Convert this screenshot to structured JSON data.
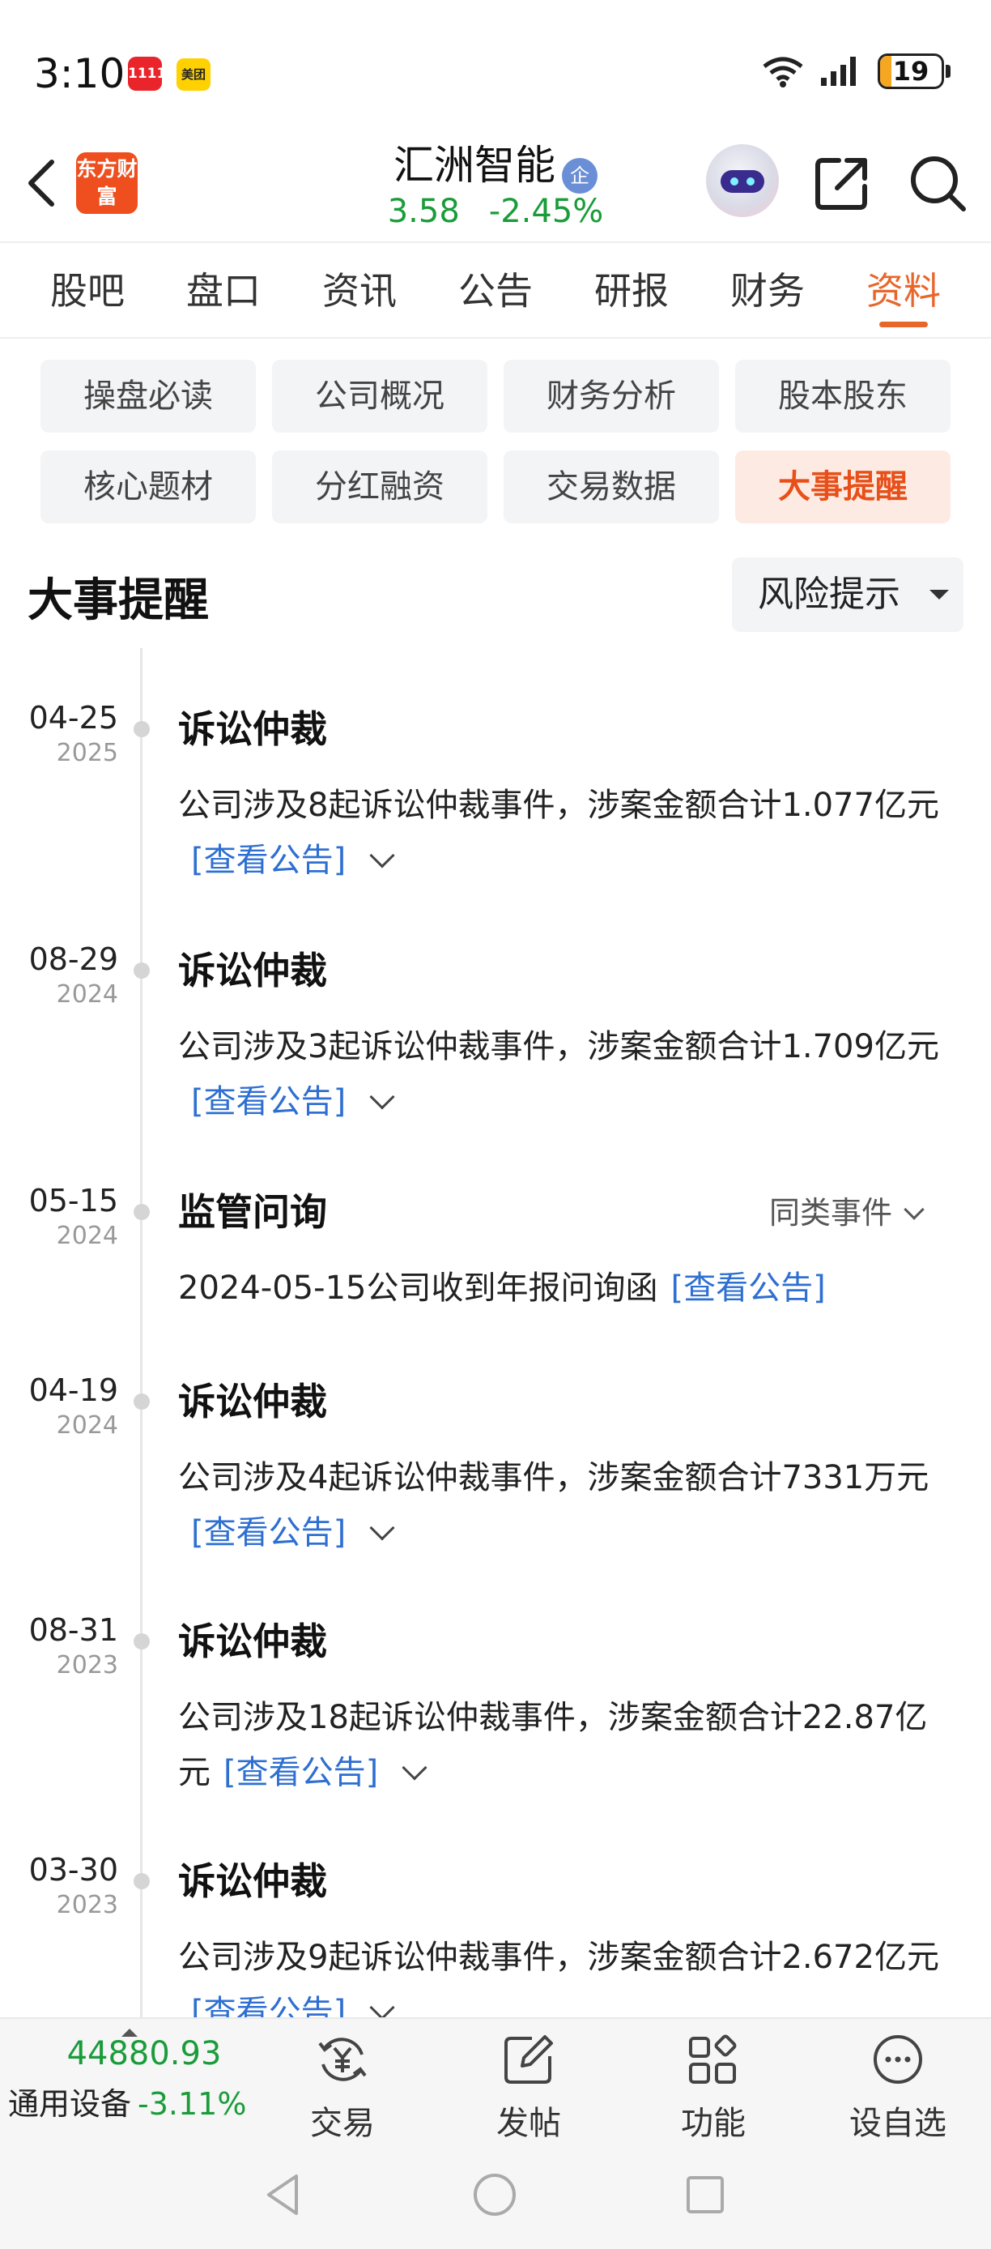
{
  "status_bar": {
    "time": "3:10",
    "app_icon_1": "1111",
    "app_icon_2": "美团",
    "battery": "19"
  },
  "header": {
    "logo_text": "东方财富",
    "stock_name": "汇洲智能",
    "badge": "企",
    "price": "3.58",
    "change_pct": "-2.45%",
    "price_color": "#1a9c3a"
  },
  "tabs": [
    "股吧",
    "盘口",
    "资讯",
    "公告",
    "研报",
    "财务",
    "资料"
  ],
  "active_tab": "资料",
  "subtabs": [
    "操盘必读",
    "公司概况",
    "财务分析",
    "股本股东",
    "核心题材",
    "分红融资",
    "交易数据",
    "大事提醒"
  ],
  "active_subtab": "大事提醒",
  "section": {
    "title": "大事提醒",
    "filter": "风险提示"
  },
  "events": [
    {
      "date": "04-25",
      "year": "2025",
      "title": "诉讼仲裁",
      "desc": "公司涉及8起诉讼仲裁事件，涉案金额合计1.077亿元",
      "link": "[查看公告]",
      "similar": ""
    },
    {
      "date": "08-29",
      "year": "2024",
      "title": "诉讼仲裁",
      "desc": "公司涉及3起诉讼仲裁事件，涉案金额合计1.709亿元",
      "link": "[查看公告]",
      "similar": ""
    },
    {
      "date": "05-15",
      "year": "2024",
      "title": "监管问询",
      "desc": "2024-05-15公司收到年报问询函",
      "link": "[查看公告]",
      "similar": "同类事件"
    },
    {
      "date": "04-19",
      "year": "2024",
      "title": "诉讼仲裁",
      "desc": "公司涉及4起诉讼仲裁事件，涉案金额合计7331万元",
      "link": "[查看公告]",
      "similar": ""
    },
    {
      "date": "08-31",
      "year": "2023",
      "title": "诉讼仲裁",
      "desc": "公司涉及18起诉讼仲裁事件，涉案金额合计22.87亿元",
      "link": "[查看公告]",
      "similar": ""
    },
    {
      "date": "03-30",
      "year": "2023",
      "title": "诉讼仲裁",
      "desc": "公司涉及9起诉讼仲裁事件，涉案金额合计2.672亿元",
      "link": "[查看公告]",
      "similar": ""
    }
  ],
  "bottom_bar": {
    "index_value": "44880.93",
    "index_name": "通用设备",
    "index_change": "-3.11%",
    "items": [
      {
        "label": "交易",
        "icon": "yuan-exchange-icon"
      },
      {
        "label": "发帖",
        "icon": "edit-post-icon"
      },
      {
        "label": "功能",
        "icon": "grid-apps-icon"
      },
      {
        "label": "设自选",
        "icon": "more-dots-icon"
      }
    ]
  }
}
